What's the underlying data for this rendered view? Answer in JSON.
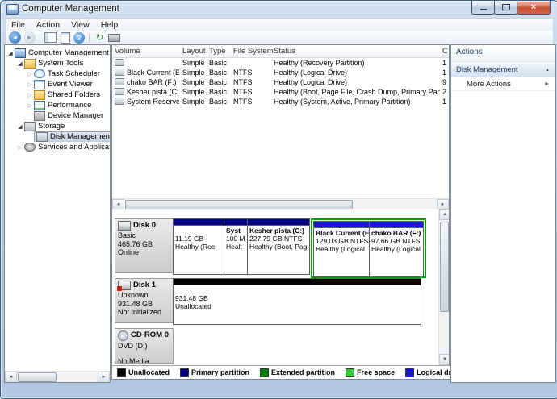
{
  "window": {
    "title": "Computer Management"
  },
  "menu_bar": {
    "items": [
      "File",
      "Action",
      "View",
      "Help"
    ]
  },
  "toolbar": {
    "buttons": [
      "back",
      "forward",
      "show-hide-console-tree",
      "export-list",
      "help",
      "refresh",
      "disk-properties"
    ]
  },
  "tree": {
    "items": [
      {
        "label": "Computer Management (Local",
        "state": "expanded",
        "selected": false
      },
      {
        "label": "System Tools",
        "state": "expanded",
        "selected": false
      },
      {
        "label": "Task Scheduler",
        "state": "collapsed",
        "selected": false
      },
      {
        "label": "Event Viewer",
        "state": "collapsed",
        "selected": false
      },
      {
        "label": "Shared Folders",
        "state": "collapsed",
        "selected": false
      },
      {
        "label": "Performance",
        "state": "collapsed",
        "selected": false
      },
      {
        "label": "Device Manager",
        "state": "leaf",
        "selected": false
      },
      {
        "label": "Storage",
        "state": "expanded",
        "selected": false
      },
      {
        "label": "Disk Management",
        "state": "leaf",
        "selected": true
      },
      {
        "label": "Services and Applications",
        "state": "collapsed",
        "selected": false
      }
    ]
  },
  "volume_list": {
    "columns": [
      "Volume",
      "Layout",
      "Type",
      "File System",
      "Status",
      "C"
    ],
    "rows": [
      {
        "volume": "",
        "layout": "Simple",
        "type": "Basic",
        "file_system": "",
        "status": "Healthy (Recovery Partition)",
        "capacity": "1"
      },
      {
        "volume": "Black Current (E:)",
        "layout": "Simple",
        "type": "Basic",
        "file_system": "NTFS",
        "status": "Healthy (Logical Drive)",
        "capacity": "1"
      },
      {
        "volume": "chako BAR (F:)",
        "layout": "Simple",
        "type": "Basic",
        "file_system": "NTFS",
        "status": "Healthy (Logical Drive)",
        "capacity": "9"
      },
      {
        "volume": "Kesher pista (C:)",
        "layout": "Simple",
        "type": "Basic",
        "file_system": "NTFS",
        "status": "Healthy (Boot, Page File, Crash Dump, Primary Partition)",
        "capacity": "2"
      },
      {
        "volume": "System Reserved",
        "layout": "Simple",
        "type": "Basic",
        "file_system": "NTFS",
        "status": "Healthy (System, Active, Primary Partition)",
        "capacity": "1"
      }
    ]
  },
  "disk_view": {
    "disks": [
      {
        "name": "Disk 0",
        "kind": "Basic",
        "size": "465.76 GB",
        "status": "Online",
        "partitions": [
          {
            "line1": "",
            "line2": "11.19 GB",
            "line3": "Healthy (Rec",
            "type": "primary"
          },
          {
            "line1": "Syst",
            "line2": "100 M",
            "line3": "Healt",
            "type": "primary"
          },
          {
            "line1": "Kesher pista (C:)",
            "line2": "227.79 GB NTFS",
            "line3": "Healthy (Boot, Pag",
            "type": "primary"
          },
          {
            "line1": "Black Current (E",
            "line2": "129.03 GB NTFS",
            "line3": "Healthy (Logical",
            "type": "logical"
          },
          {
            "line1": "chako BAR (F:)",
            "line2": "97.66 GB NTFS",
            "line3": "Healthy (Logical",
            "type": "logical"
          }
        ]
      },
      {
        "name": "Disk 1",
        "kind": "Unknown",
        "size": "931.48 GB",
        "status": "Not Initialized",
        "partitions": [
          {
            "line1": "",
            "line2": "931.48 GB",
            "line3": "Unallocated",
            "type": "unallocated"
          }
        ]
      },
      {
        "name": "CD-ROM 0",
        "kind": "DVD (D:)",
        "size": "",
        "status": "No Media",
        "partitions": []
      }
    ]
  },
  "legend": {
    "items": [
      {
        "label": "Unallocated",
        "color": "#000000"
      },
      {
        "label": "Primary partition",
        "color": "#000082"
      },
      {
        "label": "Extended partition",
        "color": "#008000"
      },
      {
        "label": "Free space",
        "color": "#33cc33"
      },
      {
        "label": "Logical drive",
        "color": "#1616d9"
      }
    ]
  },
  "actions_panel": {
    "title": "Actions",
    "sections": [
      {
        "label": "Disk Management"
      },
      {
        "label": "More Actions"
      }
    ]
  }
}
